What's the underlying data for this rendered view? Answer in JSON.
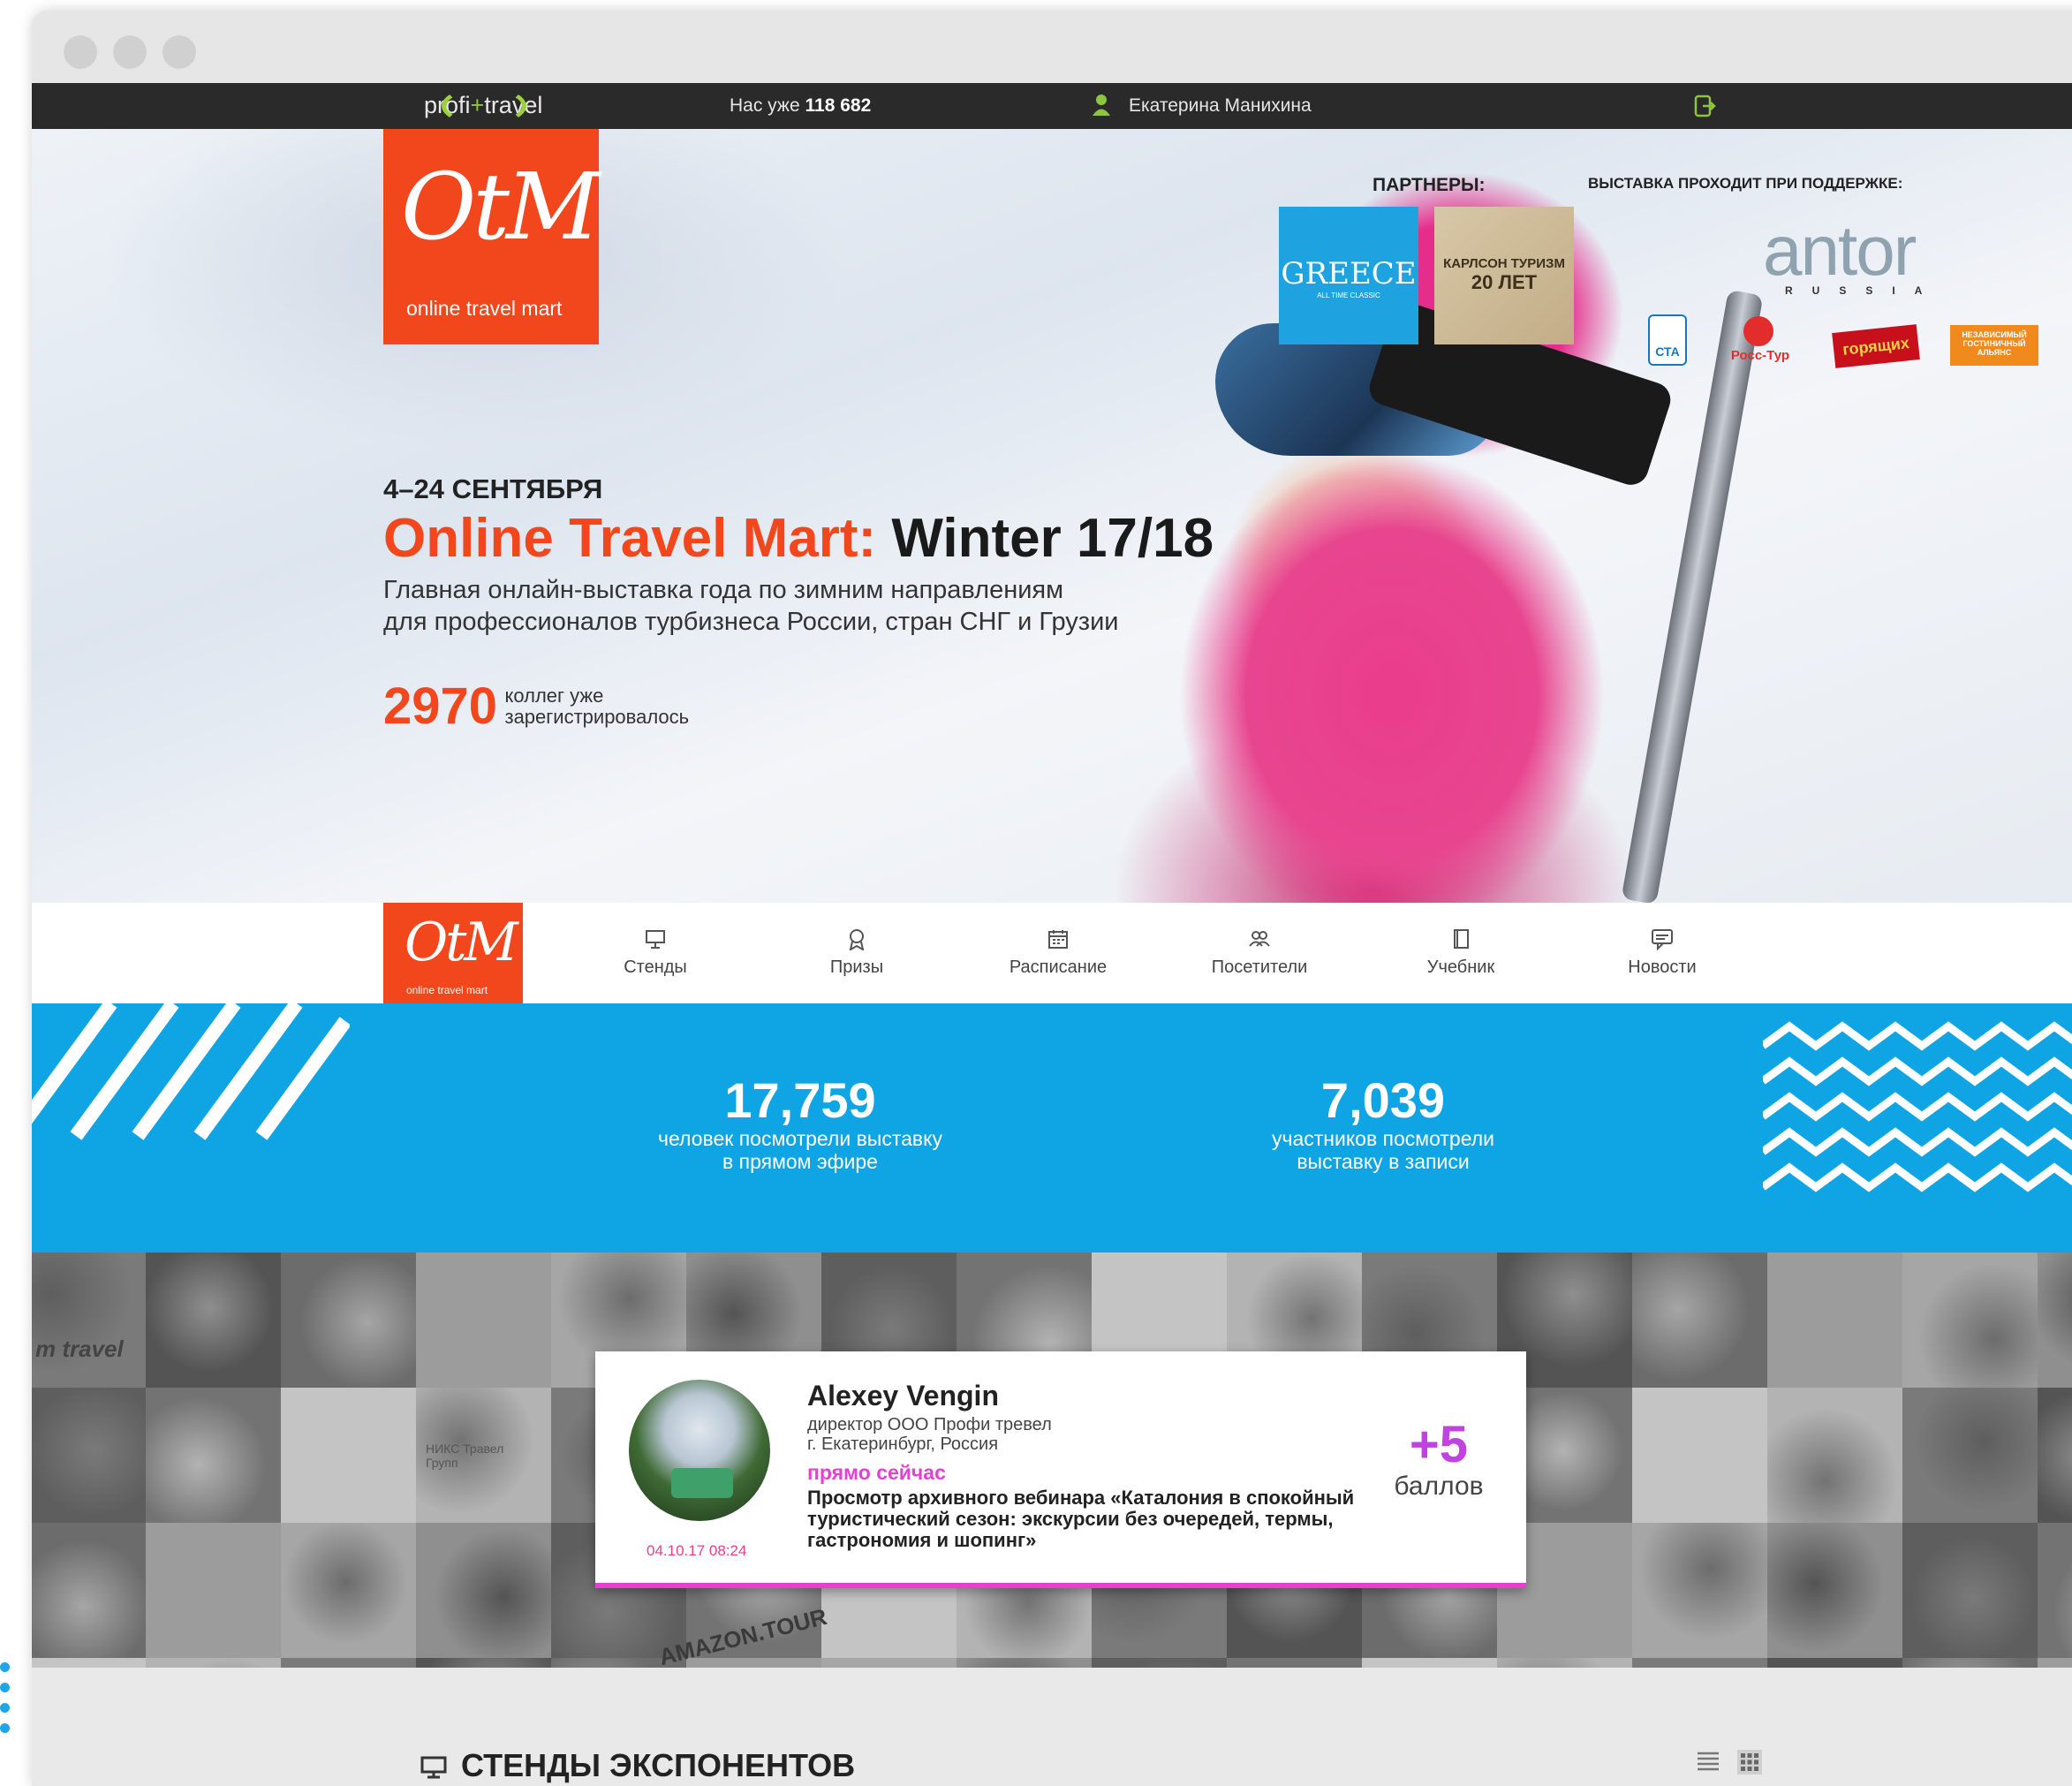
{
  "topbar": {
    "logo": {
      "left": "profi",
      "plus": "+",
      "right": "travel"
    },
    "count_prefix": "Нас уже",
    "count_value": "118 682",
    "user_name": "Екатерина Манихина"
  },
  "hero": {
    "brand_mark": "OtM",
    "brand_sub": "online travel mart",
    "partners_label": "ПАРТНЕРЫ:",
    "support_label": "ВЫСТАВКА ПРОХОДИТ ПРИ ПОДДЕРЖКЕ:",
    "partner_greece": "GREECE",
    "partner_greece_sub": "ALL TIME CLASSIC",
    "partner_karlson": "КАРЛСОН ТУРИЗМ",
    "partner_karlson_big": "20 ЛЕТ",
    "support_antor": "antor",
    "support_antor_sub": "RUSSIA",
    "support_cta": "СТА",
    "support_rosstur": "Росс-Тур",
    "support_gor": "горящих",
    "support_alians": "НЕЗАВИСИМЫЙ ГОСТИНИЧНЫЙ АЛЬЯНС",
    "date": "4–24 СЕНТЯБРЯ",
    "title_accent": "Online Travel Mart:",
    "title_rest": "Winter 17/18",
    "desc_line1": "Главная онлайн-выставка года по зимним направлениям",
    "desc_line2": "для профессионалов турбизнеса России, стран СНГ и Грузии",
    "reg_count": "2970",
    "reg_line1": "коллег уже",
    "reg_line2": "зарегистрировалось"
  },
  "nav": {
    "brand_mark": "OtM",
    "brand_sub": "online travel mart",
    "items": [
      {
        "label": "Стенды",
        "icon": "monitor-icon"
      },
      {
        "label": "Призы",
        "icon": "award-icon"
      },
      {
        "label": "Расписание",
        "icon": "calendar-icon"
      },
      {
        "label": "Посетители",
        "icon": "users-icon"
      },
      {
        "label": "Учебник",
        "icon": "book-icon"
      },
      {
        "label": "Новости",
        "icon": "chat-icon"
      }
    ]
  },
  "stats": {
    "live": {
      "value": "17,759",
      "line1": "человек посмотрели выставку",
      "line2": "в прямом эфире"
    },
    "recorded": {
      "value": "7,039",
      "line1": "участников посмотрели",
      "line2": "выставку в записи"
    }
  },
  "mosaic": {
    "tile_texts": {
      "travel": "m travel",
      "niks": "НИКС Травел Групп",
      "amazon": "AMAZON.TOUR"
    }
  },
  "activity": {
    "name": "Alexey Vengin",
    "role_line1": "директор ООО Профи тревел",
    "role_line2": "г. Екатеринбург, Россия",
    "status": "прямо сейчас",
    "action": "Просмотр архивного вебинара «Каталония в спокойный туристический сезон: экскурсии без очередей, термы, гастрономия и шопинг»",
    "timestamp": "04.10.17 08:24",
    "points_value": "+5",
    "points_unit": "баллов"
  },
  "section": {
    "title": "СТЕНДЫ ЭКСПОНЕНТОВ"
  },
  "colors": {
    "accent": "#f2461d",
    "blue": "#0fa4e3",
    "magenta": "#e53fd3",
    "green": "#8cc63f"
  }
}
